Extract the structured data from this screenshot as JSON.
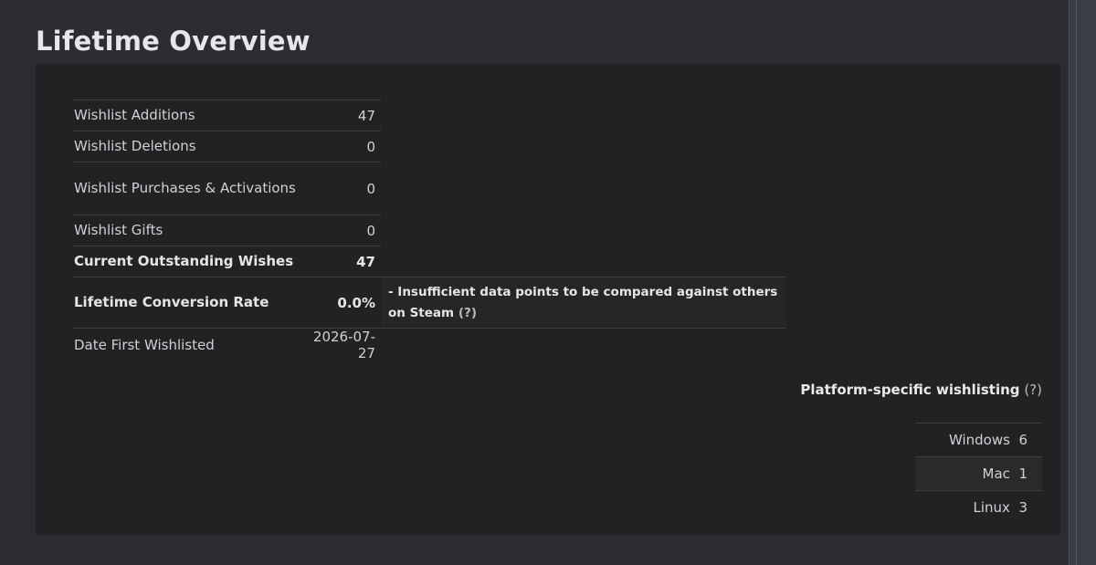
{
  "title": "Lifetime Overview",
  "stats": [
    {
      "label": "Wishlist Additions",
      "value": "47"
    },
    {
      "label": "Wishlist Deletions",
      "value": "0"
    },
    {
      "label": "Wishlist Purchases & Activations",
      "value": "0"
    },
    {
      "label": "Wishlist Gifts",
      "value": "0"
    },
    {
      "label": "Current Outstanding Wishes",
      "value": "47"
    },
    {
      "label": "Lifetime Conversion Rate",
      "value": "0.0%",
      "note": "- Insufficient data points to be compared against others on Steam",
      "help": "(?)"
    },
    {
      "label": "Date First Wishlisted",
      "value": "2026-07-27"
    }
  ],
  "platform": {
    "title": "Platform-specific wishlisting",
    "help": "(?)",
    "rows": [
      {
        "name": "Windows",
        "count": "6"
      },
      {
        "name": "Mac",
        "count": "1"
      },
      {
        "name": "Linux",
        "count": "3"
      }
    ]
  }
}
